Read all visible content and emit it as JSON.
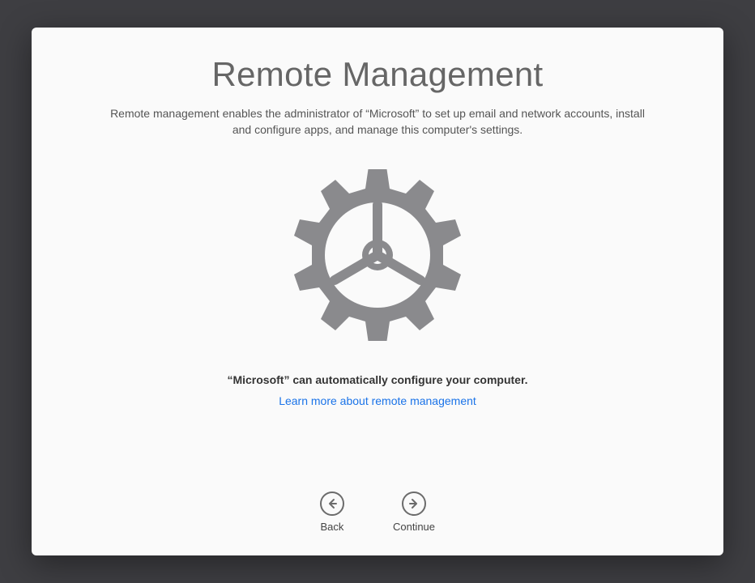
{
  "header": {
    "title": "Remote Management",
    "description": "Remote management enables the administrator of “Microsoft” to set up email and network accounts, install and configure apps, and manage this computer's settings."
  },
  "body": {
    "statement": "“Microsoft” can automatically configure your computer.",
    "learn_more_label": "Learn more about remote management"
  },
  "footer": {
    "back_label": "Back",
    "continue_label": "Continue"
  }
}
